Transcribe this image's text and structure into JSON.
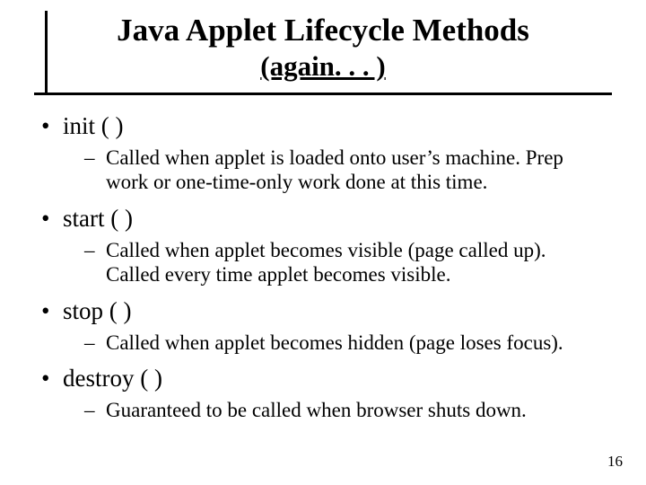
{
  "title": "Java Applet Lifecycle Methods",
  "subtitle": "(again. . . )",
  "bullets": [
    {
      "label": "init ( )",
      "sub": "Called when applet is loaded onto user’s machine. Prep work or one-time-only work done at this time."
    },
    {
      "label": "start ( )",
      "sub": "Called when applet becomes visible (page called up). Called every time applet becomes visible."
    },
    {
      "label": "stop ( )",
      "sub": "Called when applet becomes hidden (page loses focus)."
    },
    {
      "label": "destroy ( )",
      "sub": "Guaranteed to be called when browser shuts down."
    }
  ],
  "page_number": "16"
}
